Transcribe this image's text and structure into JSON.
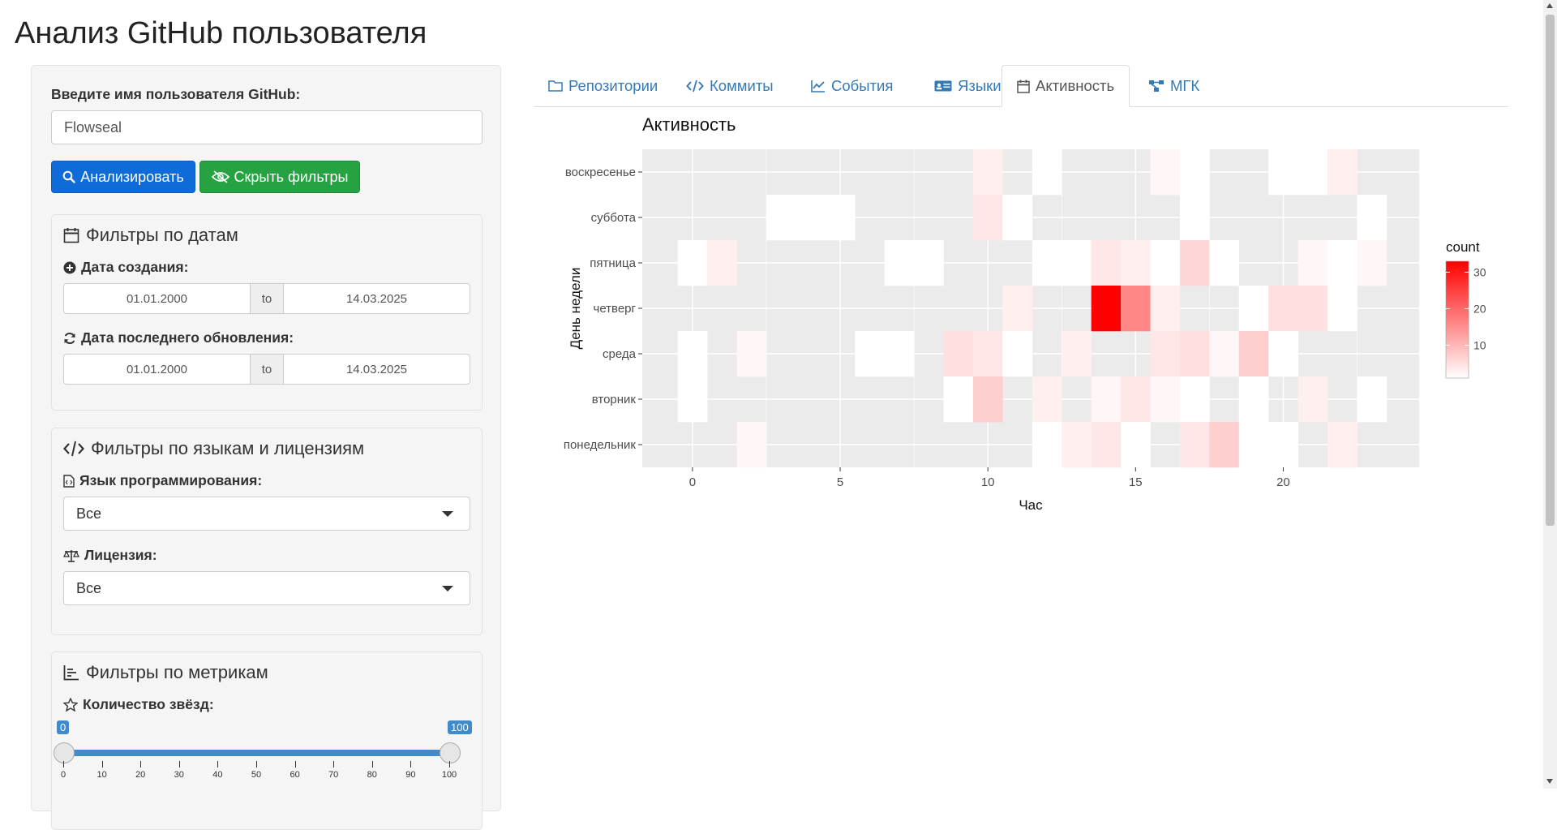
{
  "app": {
    "title": "Анализ GitHub пользователя"
  },
  "sidebar": {
    "username_label": "Введите имя пользователя GitHub:",
    "username_value": "Flowseal",
    "analyze_button": "Анализировать",
    "hide_filters_button": "Скрыть фильтры",
    "date_filters": {
      "title": "Фильтры по датам",
      "created_label": "Дата создания:",
      "created_from": "01.01.2000",
      "created_to": "14.03.2025",
      "range_sep": "to",
      "updated_label": "Дата последнего обновления:",
      "updated_from": "01.01.2000",
      "updated_to": "14.03.2025"
    },
    "lang_filters": {
      "title": "Фильтры по языкам и лицензиям",
      "language_label": "Язык программирования:",
      "language_value": "Все",
      "license_label": "Лицензия:",
      "license_value": "Все"
    },
    "metric_filters": {
      "title": "Фильтры по метрикам",
      "stars_label": "Количество звёзд:",
      "stars_min": 0,
      "stars_max": 100,
      "stars_min_label": "0",
      "stars_max_label": "100",
      "tick_labels": [
        "0",
        "10",
        "20",
        "30",
        "40",
        "50",
        "60",
        "70",
        "80",
        "90",
        "100"
      ]
    }
  },
  "tabs": [
    {
      "label": "Репозитории",
      "icon": "folder-icon",
      "active": false
    },
    {
      "label": "Коммиты",
      "icon": "code-icon",
      "active": false
    },
    {
      "label": "События",
      "icon": "line-chart-icon",
      "active": false
    },
    {
      "label": "Языки",
      "icon": "id-card-icon",
      "active": false
    },
    {
      "label": "Активность",
      "icon": "calendar-icon",
      "active": true
    },
    {
      "label": "МГК",
      "icon": "sitemap-icon",
      "active": false
    }
  ],
  "chart_data": {
    "type": "heatmap",
    "title": "Активность",
    "xlabel": "Час",
    "ylabel": "День недели",
    "x_ticks": [
      "0",
      "5",
      "10",
      "15",
      "20"
    ],
    "xlim": [
      -1.7,
      24.6
    ],
    "categories": [
      "понедельник",
      "вторник",
      "среда",
      "четверг",
      "пятница",
      "суббота",
      "воскресенье"
    ],
    "legend": {
      "title": "count",
      "ticks": [
        "10",
        "20",
        "30"
      ],
      "low_color": "#ffffff",
      "high_color": "#ff0000",
      "min": 1,
      "max": 33,
      "placement": "right"
    },
    "cells": [
      {
        "day": "воскресенье",
        "hour": 10,
        "count": 3
      },
      {
        "day": "воскресенье",
        "hour": 12,
        "count": 1
      },
      {
        "day": "воскресенье",
        "hour": 16,
        "count": 2
      },
      {
        "day": "воскресенье",
        "hour": 17,
        "count": 1
      },
      {
        "day": "воскресенье",
        "hour": 20,
        "count": 1
      },
      {
        "day": "воскресенье",
        "hour": 21,
        "count": 1
      },
      {
        "day": "воскресенье",
        "hour": 22,
        "count": 3
      },
      {
        "day": "суббота",
        "hour": 3,
        "count": 1
      },
      {
        "day": "суббота",
        "hour": 4,
        "count": 1
      },
      {
        "day": "суббота",
        "hour": 5,
        "count": 1
      },
      {
        "day": "суббота",
        "hour": 10,
        "count": 4
      },
      {
        "day": "суббота",
        "hour": 11,
        "count": 1
      },
      {
        "day": "суббота",
        "hour": 17,
        "count": 1
      },
      {
        "day": "суббота",
        "hour": 23,
        "count": 1
      },
      {
        "day": "пятница",
        "hour": 0,
        "count": 1
      },
      {
        "day": "пятница",
        "hour": 1,
        "count": 3
      },
      {
        "day": "пятница",
        "hour": 7,
        "count": 1
      },
      {
        "day": "пятница",
        "hour": 8,
        "count": 1
      },
      {
        "day": "пятница",
        "hour": 12,
        "count": 1
      },
      {
        "day": "пятница",
        "hour": 13,
        "count": 1
      },
      {
        "day": "пятница",
        "hour": 14,
        "count": 4
      },
      {
        "day": "пятница",
        "hour": 15,
        "count": 3
      },
      {
        "day": "пятница",
        "hour": 16,
        "count": 1
      },
      {
        "day": "пятница",
        "hour": 17,
        "count": 6
      },
      {
        "day": "пятница",
        "hour": 18,
        "count": 1
      },
      {
        "day": "пятница",
        "hour": 21,
        "count": 2
      },
      {
        "day": "пятница",
        "hour": 22,
        "count": 1
      },
      {
        "day": "пятница",
        "hour": 23,
        "count": 2
      },
      {
        "day": "четверг",
        "hour": 11,
        "count": 3
      },
      {
        "day": "четверг",
        "hour": 14,
        "count": 33
      },
      {
        "day": "четверг",
        "hour": 15,
        "count": 16
      },
      {
        "day": "четверг",
        "hour": 16,
        "count": 3
      },
      {
        "day": "четверг",
        "hour": 19,
        "count": 1
      },
      {
        "day": "четверг",
        "hour": 20,
        "count": 5
      },
      {
        "day": "четверг",
        "hour": 21,
        "count": 5
      },
      {
        "day": "четверг",
        "hour": 22,
        "count": 1
      },
      {
        "day": "среда",
        "hour": 0,
        "count": 1
      },
      {
        "day": "среда",
        "hour": 2,
        "count": 2
      },
      {
        "day": "среда",
        "hour": 6,
        "count": 1
      },
      {
        "day": "среда",
        "hour": 7,
        "count": 1
      },
      {
        "day": "среда",
        "hour": 9,
        "count": 5
      },
      {
        "day": "среда",
        "hour": 10,
        "count": 4
      },
      {
        "day": "среда",
        "hour": 11,
        "count": 1
      },
      {
        "day": "среда",
        "hour": 13,
        "count": 3
      },
      {
        "day": "среда",
        "hour": 16,
        "count": 4
      },
      {
        "day": "среда",
        "hour": 17,
        "count": 5
      },
      {
        "day": "среда",
        "hour": 18,
        "count": 2
      },
      {
        "day": "среда",
        "hour": 19,
        "count": 7
      },
      {
        "day": "среда",
        "hour": 20,
        "count": 1
      },
      {
        "day": "вторник",
        "hour": 0,
        "count": 1
      },
      {
        "day": "вторник",
        "hour": 9,
        "count": 1
      },
      {
        "day": "вторник",
        "hour": 10,
        "count": 7
      },
      {
        "day": "вторник",
        "hour": 12,
        "count": 3
      },
      {
        "day": "вторник",
        "hour": 14,
        "count": 2
      },
      {
        "day": "вторник",
        "hour": 15,
        "count": 4
      },
      {
        "day": "вторник",
        "hour": 16,
        "count": 2
      },
      {
        "day": "вторник",
        "hour": 17,
        "count": 1
      },
      {
        "day": "вторник",
        "hour": 19,
        "count": 1
      },
      {
        "day": "вторник",
        "hour": 21,
        "count": 3
      },
      {
        "day": "вторник",
        "hour": 23,
        "count": 1
      },
      {
        "day": "понедельник",
        "hour": 2,
        "count": 2
      },
      {
        "day": "понедельник",
        "hour": 12,
        "count": 1
      },
      {
        "day": "понедельник",
        "hour": 13,
        "count": 3
      },
      {
        "day": "понедельник",
        "hour": 14,
        "count": 4
      },
      {
        "day": "понедельник",
        "hour": 15,
        "count": 1
      },
      {
        "day": "понедельник",
        "hour": 17,
        "count": 4
      },
      {
        "day": "понедельник",
        "hour": 18,
        "count": 7
      },
      {
        "day": "понедельник",
        "hour": 19,
        "count": 1
      },
      {
        "day": "понедельник",
        "hour": 20,
        "count": 1
      },
      {
        "day": "понедельник",
        "hour": 22,
        "count": 3
      }
    ]
  },
  "colors": {
    "primary": "#0e6bd8",
    "success": "#26a243",
    "link": "#337ab7",
    "panel_bg": "#ebebeb"
  }
}
